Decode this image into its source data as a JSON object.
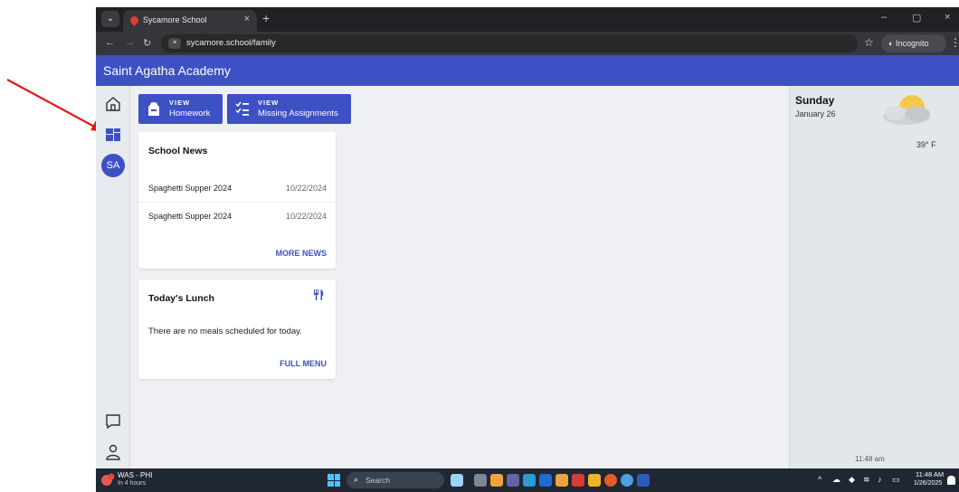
{
  "browser": {
    "tab_title": "Sycamore School",
    "tab_close": "×",
    "new_tab": "+",
    "url": "sycamore.school/family",
    "incognito_label": "Incognito",
    "minimize": "–",
    "restore": "▢",
    "close": "×"
  },
  "app": {
    "title": "Saint Agatha Academy"
  },
  "quick_buttons": [
    {
      "small": "VIEW",
      "label": "Homework"
    },
    {
      "small": "VIEW",
      "label": "Missing Assignments"
    }
  ],
  "avatar": {
    "initials": "SA"
  },
  "school_news": {
    "title": "School News",
    "items": [
      {
        "title": "Spaghetti Supper 2024",
        "date": "10/22/2024"
      },
      {
        "title": "Spaghetti Supper 2024",
        "date": "10/22/2024"
      }
    ],
    "more_label": "MORE NEWS"
  },
  "lunch": {
    "title": "Today's Lunch",
    "message": "There are no meals scheduled for today.",
    "menu_label": "FULL MENU"
  },
  "weather": {
    "day": "Sunday",
    "date": "January 26",
    "temp": "39° F",
    "updated": "11:48 am"
  },
  "taskbar": {
    "location": "WAS - PHI",
    "sublabel": "In 4 hours",
    "search_placeholder": "Search",
    "time": "11:48 AM",
    "date": "1/26/2025"
  },
  "icons": {
    "rail": [
      "home-icon",
      "dashboard-icon",
      "chat-icon",
      "person-icon"
    ],
    "lunch": "fork-knife-icon",
    "weather": "partly-cloudy-icon"
  },
  "colors": {
    "brand": "#3d51c4",
    "page_bg": "#eef0f3",
    "link": "#3d51c4",
    "annotation": "#e11919"
  }
}
